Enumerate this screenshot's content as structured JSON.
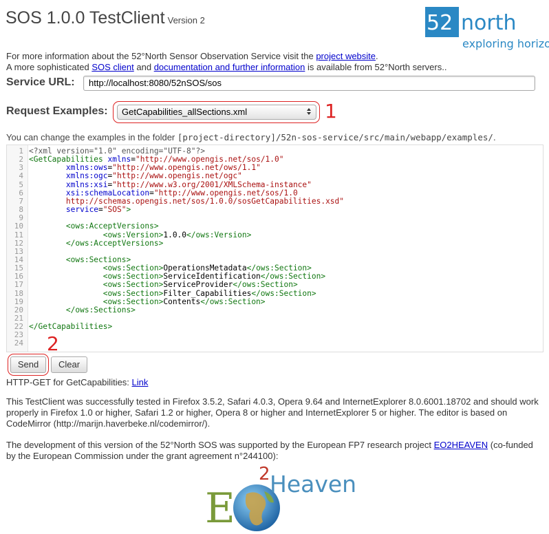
{
  "header": {
    "title": "SOS 1.0.0 TestClient",
    "version": "Version 2",
    "logo": {
      "brand_num": "52",
      "brand_word": "north",
      "tagline": "exploring horizons",
      "color": "#2a88c4"
    }
  },
  "info": {
    "line1_prefix": "For more information about the 52°North Sensor Observation Service visit the",
    "line1_link": "project website",
    "line1_suffix": ".",
    "line2_prefix": "A more sophisticated",
    "line2_link1": "SOS client",
    "line2_mid": "and",
    "line2_link2": "documentation and further information",
    "line2_suffix": "is available from 52°North servers.."
  },
  "service_url": {
    "label": "Service URL:",
    "value": "http://localhost:8080/52nSOS/sos"
  },
  "request_examples": {
    "label": "Request Examples:",
    "selected": "GetCapabilities_allSections.xml",
    "annotation_number": "1"
  },
  "hint": {
    "prefix": "You can change the examples in the folder",
    "path": "[project-directory]/52n-sos-service/src/main/webapp/examples/",
    "suffix": "."
  },
  "editor": {
    "lines": [
      {
        "n": "1"
      },
      {
        "n": "2"
      },
      {
        "n": "3"
      },
      {
        "n": "4"
      },
      {
        "n": "5"
      },
      {
        "n": "6"
      },
      {
        "n": "7"
      },
      {
        "n": "8"
      },
      {
        "n": "9"
      },
      {
        "n": "10"
      },
      {
        "n": "11"
      },
      {
        "n": "12"
      },
      {
        "n": "13"
      },
      {
        "n": "14"
      },
      {
        "n": "15"
      },
      {
        "n": "16"
      },
      {
        "n": "17"
      },
      {
        "n": "18"
      },
      {
        "n": "19"
      },
      {
        "n": "20"
      },
      {
        "n": "21"
      },
      {
        "n": "22"
      },
      {
        "n": "23"
      },
      {
        "n": "24"
      }
    ],
    "code": {
      "l1": "<?xml version=\"1.0\" encoding=\"UTF-8\"?>",
      "l2_tag": "<GetCapabilities",
      "l2_attr": "xmlns",
      "l2_val": "\"http://www.opengis.net/sos/1.0\"",
      "l3_attr": "xmlns:ows",
      "l3_val": "\"http://www.opengis.net/ows/1.1\"",
      "l4_attr": "xmlns:ogc",
      "l4_val": "\"http://www.opengis.net/ogc\"",
      "l5_attr": "xmlns:xsi",
      "l5_val": "\"http://www.w3.org/2001/XMLSchema-instance\"",
      "l6_attr": "xsi:schemaLocation",
      "l6_val": "\"http://www.opengis.net/sos/1.0",
      "l7_val": "http://schemas.opengis.net/sos/1.0.0/sosGetCapabilities.xsd\"",
      "l8_attr": "service",
      "l8_val": "\"SOS\"",
      "l8_close": ">",
      "l10": "<ows:AcceptVersions>",
      "l11_open": "<ows:Version>",
      "l11_text": "1.0.0",
      "l11_close": "</ows:Version>",
      "l12": "</ows:AcceptVersions>",
      "l14": "<ows:Sections>",
      "sec_open": "<ows:Section>",
      "sec_close": "</ows:Section>",
      "l15_text": "OperationsMetadata",
      "l16_text": "ServiceIdentification",
      "l17_text": "ServiceProvider",
      "l18_text": "Filter_Capabilities",
      "l19_text": "Contents",
      "l20": "</ows:Sections>",
      "l22": "</GetCapabilities>"
    }
  },
  "buttons": {
    "send": "Send",
    "clear": "Clear",
    "annotation_number": "2"
  },
  "http_get": {
    "label": "HTTP-GET for GetCapabilities:",
    "link": "Link"
  },
  "paragraphs": {
    "tested": "This TestClient was successfully tested in Firefox 3.5.2, Safari 4.0.3, Opera 9.64 and InternetExplorer 8.0.6001.18702 and should work properly in Firefox 1.0 or higher, Safari 1.2 or higher, Opera 8 or higher and InternetExplorer 5 or higher. The editor is based on CodeMirror (http://marijn.haverbeke.nl/codemirror/).",
    "funding_prefix": "The development of this version of the 52°North SOS was supported by the European FP7 research project",
    "funding_link": "EO2HEAVEN",
    "funding_suffix": "(co-funded by the European Commission under the grant agreement n°244100):"
  },
  "eo_logo": {
    "letter_e": "E",
    "letter_o": "O",
    "small_2": "2",
    "word": "Heaven",
    "colors": {
      "e": "#7a9a3a",
      "heaven": "#4a8fbd",
      "two": "#c0392b"
    }
  }
}
